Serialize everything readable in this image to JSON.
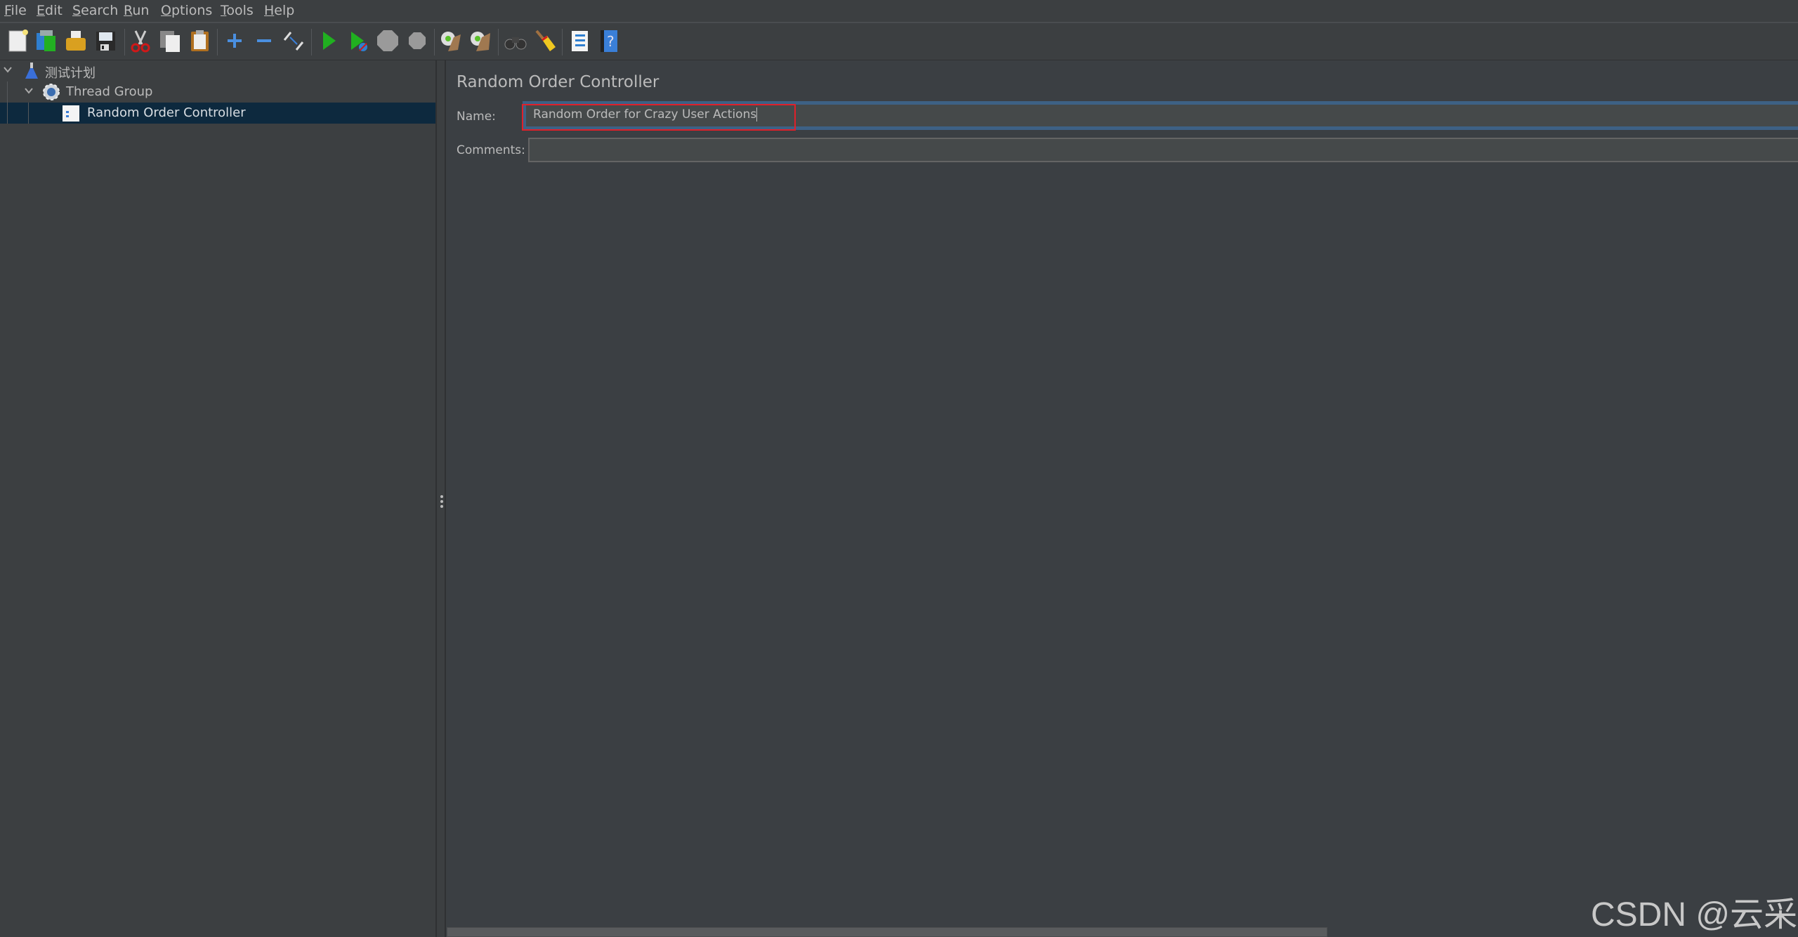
{
  "menu": {
    "items": [
      {
        "label": "File",
        "mnemonic": "F",
        "rest": "ile"
      },
      {
        "label": "Edit",
        "mnemonic": "E",
        "rest": "dit"
      },
      {
        "label": "Search",
        "mnemonic": "S",
        "rest": "earch"
      },
      {
        "label": "Run",
        "mnemonic": "R",
        "rest": "un"
      },
      {
        "label": "Options",
        "mnemonic": "O",
        "rest": "ptions"
      },
      {
        "label": "Tools",
        "mnemonic": "T",
        "rest": "ools"
      },
      {
        "label": "Help",
        "mnemonic": "H",
        "rest": "elp"
      }
    ]
  },
  "toolbar": {
    "buttons": [
      {
        "name": "new",
        "icon": "new-file-icon"
      },
      {
        "name": "templates",
        "icon": "templates-icon"
      },
      {
        "name": "open",
        "icon": "open-folder-icon"
      },
      {
        "name": "save",
        "icon": "save-icon"
      },
      {
        "name": "cut",
        "icon": "scissors-icon"
      },
      {
        "name": "copy",
        "icon": "copy-icon"
      },
      {
        "name": "paste",
        "icon": "paste-icon"
      },
      {
        "name": "expand-all",
        "icon": "plus-icon"
      },
      {
        "name": "collapse-all",
        "icon": "minus-icon"
      },
      {
        "name": "toggle",
        "icon": "toggle-icon"
      },
      {
        "name": "start",
        "icon": "play-icon"
      },
      {
        "name": "start-no-pauses",
        "icon": "play-no-timers-icon"
      },
      {
        "name": "stop",
        "icon": "stop-icon"
      },
      {
        "name": "shutdown",
        "icon": "shutdown-icon"
      },
      {
        "name": "clear",
        "icon": "broom-clear-icon"
      },
      {
        "name": "clear-all",
        "icon": "broom-clear-all-icon"
      },
      {
        "name": "search",
        "icon": "binoculars-icon"
      },
      {
        "name": "reset-search",
        "icon": "broom-icon"
      },
      {
        "name": "function-helper",
        "icon": "list-icon"
      },
      {
        "name": "help",
        "icon": "help-book-icon"
      }
    ]
  },
  "tree": {
    "items": [
      {
        "label": "测试计划",
        "icon": "test-plan-flask-icon",
        "expanded": true
      },
      {
        "label": "Thread Group",
        "icon": "thread-group-gear-icon",
        "expanded": true
      },
      {
        "label": "Random Order Controller",
        "icon": "controller-icon",
        "selected": true
      }
    ]
  },
  "panel": {
    "title": "Random Order Controller",
    "name_label": "Name:",
    "name_value": "Random Order for Crazy User Actions",
    "comments_label": "Comments:",
    "comments_value": ""
  },
  "watermark": "CSDN @云采",
  "colors": {
    "selection": "#0d293e",
    "focus_border": "#3d6185",
    "highlight_box": "#e0202a"
  }
}
